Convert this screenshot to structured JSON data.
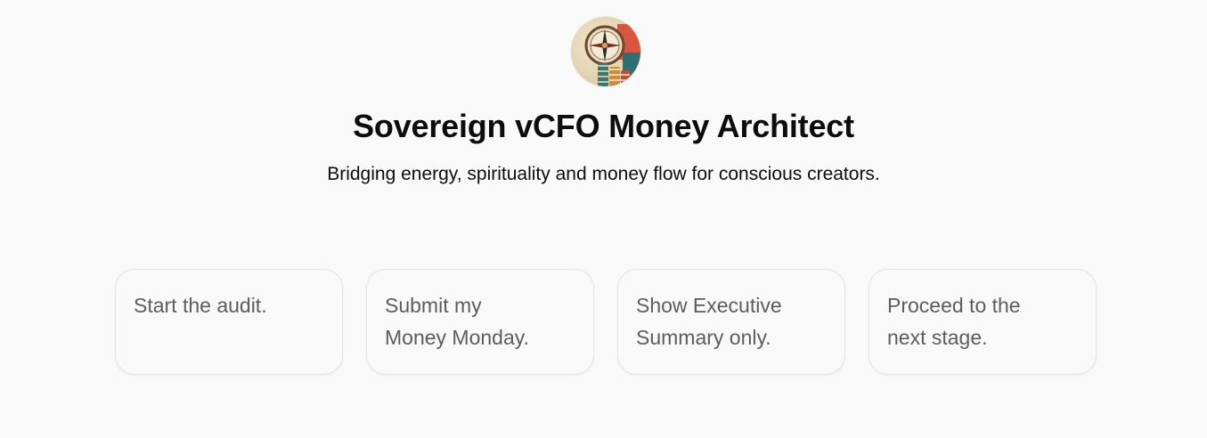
{
  "gpt": {
    "name": "Sovereign vCFO Money Architect",
    "description": "Bridging energy, spirituality and money flow for conscious creators.",
    "avatar_icon": "compass-coins-icon"
  },
  "conversation_starters": [
    {
      "label": "Start the audit."
    },
    {
      "label": "Submit my Money Monday."
    },
    {
      "label": "Show Executive Summary only."
    },
    {
      "label": "Proceed to the next stage."
    }
  ],
  "colors": {
    "background": "#f9f9f9",
    "title": "#0d0d0d",
    "starter_text": "#5d5d5d",
    "starter_border": "#e3e3e3"
  }
}
